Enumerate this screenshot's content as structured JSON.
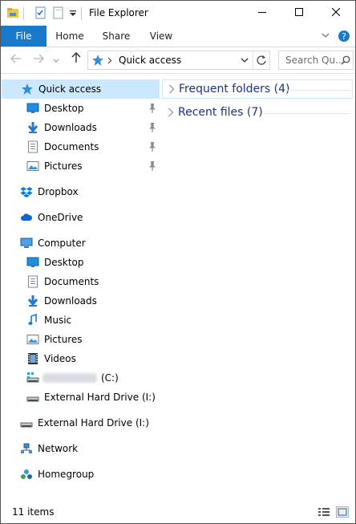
{
  "window": {
    "title": "File Explorer"
  },
  "ribbon": {
    "tabs": [
      "File",
      "Home",
      "Share",
      "View"
    ]
  },
  "address": {
    "path_segment": "Quick access"
  },
  "search": {
    "placeholder": "Search Qu..."
  },
  "nav": {
    "items": [
      {
        "name": "nav-quick-access",
        "label": "Quick access",
        "icon": "star-icon",
        "indent": 1,
        "selected": true,
        "pinned": false
      },
      {
        "name": "nav-desktop-pinned",
        "label": "Desktop",
        "icon": "desktop-icon",
        "indent": 2,
        "pinned": true
      },
      {
        "name": "nav-downloads-pinned",
        "label": "Downloads",
        "icon": "download-icon",
        "indent": 2,
        "pinned": true
      },
      {
        "name": "nav-documents-pinned",
        "label": "Documents",
        "icon": "document-icon",
        "indent": 2,
        "pinned": true
      },
      {
        "name": "nav-pictures-pinned",
        "label": "Pictures",
        "icon": "pictures-icon",
        "indent": 2,
        "pinned": true
      },
      {
        "name": "nav-dropbox",
        "label": "Dropbox",
        "icon": "dropbox-icon",
        "indent": 1
      },
      {
        "name": "nav-onedrive",
        "label": "OneDrive",
        "icon": "cloud-icon",
        "indent": 1
      },
      {
        "name": "nav-computer",
        "label": "Computer",
        "icon": "computer-icon",
        "indent": 1
      },
      {
        "name": "nav-computer-desktop",
        "label": "Desktop",
        "icon": "desktop-icon",
        "indent": 2
      },
      {
        "name": "nav-computer-documents",
        "label": "Documents",
        "icon": "document-icon",
        "indent": 2
      },
      {
        "name": "nav-computer-downloads",
        "label": "Downloads",
        "icon": "download-icon",
        "indent": 2
      },
      {
        "name": "nav-music",
        "label": "Music",
        "icon": "music-icon",
        "indent": 2
      },
      {
        "name": "nav-computer-pictures",
        "label": "Pictures",
        "icon": "pictures-icon",
        "indent": 2
      },
      {
        "name": "nav-videos",
        "label": "Videos",
        "icon": "video-icon",
        "indent": 2
      },
      {
        "name": "nav-local-disk",
        "label": "(C:)",
        "icon": "hard-drive-icon",
        "indent": 2,
        "redacted": true
      },
      {
        "name": "nav-external-drive-child",
        "label": "External Hard Drive (I:)",
        "icon": "hard-drive-icon",
        "indent": 2
      },
      {
        "name": "nav-external-drive",
        "label": "External Hard Drive (I:)",
        "icon": "hard-drive-icon",
        "indent": 1
      },
      {
        "name": "nav-network",
        "label": "Network",
        "icon": "network-icon",
        "indent": 1
      },
      {
        "name": "nav-homegroup",
        "label": "Homegroup",
        "icon": "homegroup-icon",
        "indent": 1
      }
    ]
  },
  "content": {
    "groups": [
      {
        "name": "frequent-folders-group",
        "label": "Frequent folders (4)",
        "selected": true
      },
      {
        "name": "recent-files-group",
        "label": "Recent files (7)",
        "selected": false
      }
    ]
  },
  "status": {
    "item_count": "11 items"
  },
  "colors": {
    "accent": "#1979ca",
    "selection": "#cce8ff",
    "group_text": "#1e3287"
  }
}
